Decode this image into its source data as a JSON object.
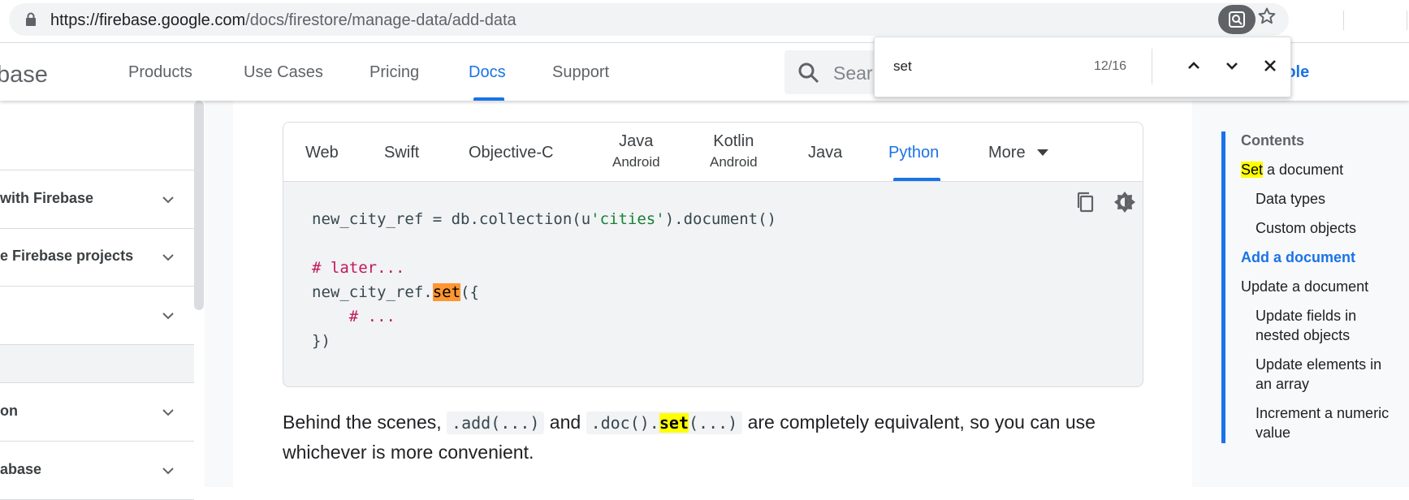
{
  "browser": {
    "url_host": "https://firebase.google.com",
    "url_path": "/docs/firestore/manage-data/add-data"
  },
  "header": {
    "brand": "base",
    "nav": [
      "Products",
      "Use Cases",
      "Pricing",
      "Docs",
      "Support"
    ],
    "active_nav": "Docs",
    "search_placeholder": "Sear",
    "console_label": "nsole"
  },
  "find_bar": {
    "query": "set",
    "count": "12/16"
  },
  "left_nav": {
    "items": [
      {
        "label": "with Firebase"
      },
      {
        "label": "e Firebase projects"
      },
      {
        "label": ""
      },
      {
        "label": ""
      },
      {
        "label": "on"
      },
      {
        "label": "abase"
      }
    ]
  },
  "code_card": {
    "tabs": [
      {
        "label": "Web"
      },
      {
        "label": "Swift"
      },
      {
        "label": "Objective-C"
      },
      {
        "label": "Java",
        "sub": "Android"
      },
      {
        "label": "Kotlin",
        "sub": "Android"
      },
      {
        "label": "Java"
      },
      {
        "label": "Python"
      },
      {
        "label": "More"
      }
    ],
    "active_tab": "Python",
    "code": {
      "line1_pre": "new_city_ref = db.collection(u",
      "line1_str": "'cities'",
      "line1_post": ").document()",
      "line3_comment": "# later...",
      "line4_pre": "new_city_ref.",
      "line4_match": "set",
      "line4_post": "({",
      "line5_indent": "    ",
      "line5_comment": "# ...",
      "line6": "})"
    }
  },
  "paragraph": {
    "t1": "Behind the scenes, ",
    "code1": ".add(...)",
    "t2": " and ",
    "code2_pre": ".doc().",
    "code2_match": "set",
    "code2_post": "(...)",
    "t3": " are completely equivalent, so you can use whichever is more convenient."
  },
  "toc": {
    "title": "Contents",
    "item1_match": "Set",
    "item1_rest": " a document",
    "items": [
      "Data types",
      "Custom objects",
      "Add a document",
      "Update a document",
      "Update fields in nested objects",
      "Update elements in an array",
      "Increment a numeric value"
    ],
    "active": "Add a document"
  },
  "colors": {
    "accent": "#1a73e8",
    "find_active_highlight": "#ff9632",
    "find_highlight": "#ffff00",
    "code_string": "#188038",
    "code_comment": "#c2185b"
  },
  "icons": [
    "lock-icon",
    "search-icon",
    "star-icon",
    "chevron-up-icon",
    "chevron-down-icon",
    "close-icon",
    "copy-icon",
    "dark-theme-icon",
    "caret-down-icon"
  ]
}
